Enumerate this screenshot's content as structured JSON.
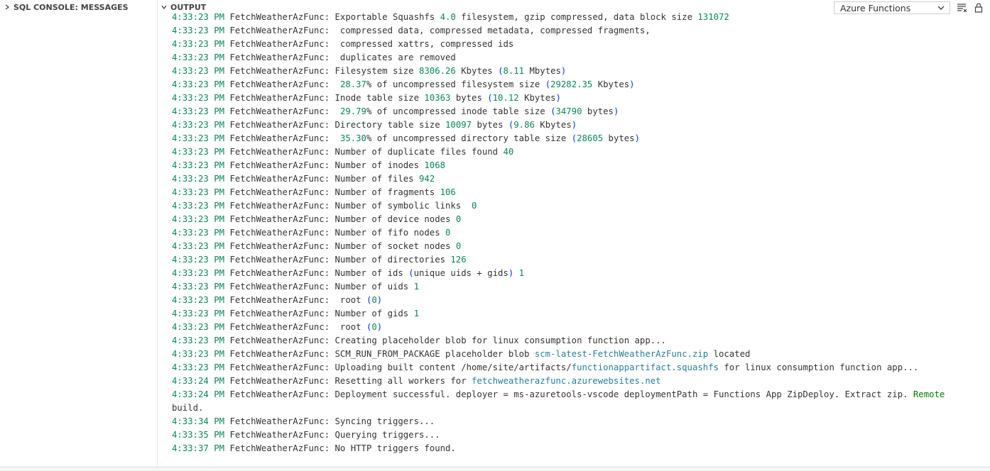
{
  "left_panel": {
    "title": "SQL CONSOLE: MESSAGES"
  },
  "output_panel": {
    "title": "OUTPUT",
    "channel_select": {
      "value": "Azure Functions"
    }
  },
  "log": {
    "prefix": "FetchWeatherAzFunc:",
    "lines": [
      {
        "ts": "4:33:23 PM",
        "parts": [
          {
            "t": "Exportable Squashfs "
          },
          {
            "t": "4.0",
            "c": "num"
          },
          {
            "t": " filesystem, gzip compressed, data block size "
          },
          {
            "t": "131072",
            "c": "num"
          }
        ]
      },
      {
        "ts": "4:33:23 PM",
        "parts": [
          {
            "t": " compressed data, compressed metadata, compressed fragments,"
          }
        ]
      },
      {
        "ts": "4:33:23 PM",
        "parts": [
          {
            "t": " compressed xattrs, compressed ids"
          }
        ]
      },
      {
        "ts": "4:33:23 PM",
        "parts": [
          {
            "t": " duplicates are removed"
          }
        ]
      },
      {
        "ts": "4:33:23 PM",
        "parts": [
          {
            "t": "Filesystem size "
          },
          {
            "t": "8306.26",
            "c": "num"
          },
          {
            "t": " Kbytes "
          },
          {
            "t": "(",
            "c": "paren"
          },
          {
            "t": "8.11",
            "c": "num"
          },
          {
            "t": " Mbytes"
          },
          {
            "t": ")",
            "c": "paren"
          }
        ]
      },
      {
        "ts": "4:33:23 PM",
        "parts": [
          {
            "t": " "
          },
          {
            "t": "28.37",
            "c": "num"
          },
          {
            "t": "% of uncompressed filesystem size "
          },
          {
            "t": "(",
            "c": "paren"
          },
          {
            "t": "29282.35",
            "c": "num"
          },
          {
            "t": " Kbytes"
          },
          {
            "t": ")",
            "c": "paren"
          }
        ]
      },
      {
        "ts": "4:33:23 PM",
        "parts": [
          {
            "t": "Inode table size "
          },
          {
            "t": "10363",
            "c": "num"
          },
          {
            "t": " bytes "
          },
          {
            "t": "(",
            "c": "paren"
          },
          {
            "t": "10.12",
            "c": "num"
          },
          {
            "t": " Kbytes"
          },
          {
            "t": ")",
            "c": "paren"
          }
        ]
      },
      {
        "ts": "4:33:23 PM",
        "parts": [
          {
            "t": " "
          },
          {
            "t": "29.79",
            "c": "num"
          },
          {
            "t": "% of uncompressed inode table size "
          },
          {
            "t": "(",
            "c": "paren"
          },
          {
            "t": "34790",
            "c": "num"
          },
          {
            "t": " bytes"
          },
          {
            "t": ")",
            "c": "paren"
          }
        ]
      },
      {
        "ts": "4:33:23 PM",
        "parts": [
          {
            "t": "Directory table size "
          },
          {
            "t": "10097",
            "c": "num"
          },
          {
            "t": " bytes "
          },
          {
            "t": "(",
            "c": "paren"
          },
          {
            "t": "9.86",
            "c": "num"
          },
          {
            "t": " Kbytes"
          },
          {
            "t": ")",
            "c": "paren"
          }
        ]
      },
      {
        "ts": "4:33:23 PM",
        "parts": [
          {
            "t": " "
          },
          {
            "t": "35.30",
            "c": "num"
          },
          {
            "t": "% of uncompressed directory table size "
          },
          {
            "t": "(",
            "c": "paren"
          },
          {
            "t": "28605",
            "c": "num"
          },
          {
            "t": " bytes"
          },
          {
            "t": ")",
            "c": "paren"
          }
        ]
      },
      {
        "ts": "4:33:23 PM",
        "parts": [
          {
            "t": "Number of duplicate files found "
          },
          {
            "t": "40",
            "c": "num"
          }
        ]
      },
      {
        "ts": "4:33:23 PM",
        "parts": [
          {
            "t": "Number of inodes "
          },
          {
            "t": "1068",
            "c": "num"
          }
        ]
      },
      {
        "ts": "4:33:23 PM",
        "parts": [
          {
            "t": "Number of files "
          },
          {
            "t": "942",
            "c": "num"
          }
        ]
      },
      {
        "ts": "4:33:23 PM",
        "parts": [
          {
            "t": "Number of fragments "
          },
          {
            "t": "106",
            "c": "num"
          }
        ]
      },
      {
        "ts": "4:33:23 PM",
        "parts": [
          {
            "t": "Number of symbolic links  "
          },
          {
            "t": "0",
            "c": "num"
          }
        ]
      },
      {
        "ts": "4:33:23 PM",
        "parts": [
          {
            "t": "Number of device nodes "
          },
          {
            "t": "0",
            "c": "num"
          }
        ]
      },
      {
        "ts": "4:33:23 PM",
        "parts": [
          {
            "t": "Number of fifo nodes "
          },
          {
            "t": "0",
            "c": "num"
          }
        ]
      },
      {
        "ts": "4:33:23 PM",
        "parts": [
          {
            "t": "Number of socket nodes "
          },
          {
            "t": "0",
            "c": "num"
          }
        ]
      },
      {
        "ts": "4:33:23 PM",
        "parts": [
          {
            "t": "Number of directories "
          },
          {
            "t": "126",
            "c": "num"
          }
        ]
      },
      {
        "ts": "4:33:23 PM",
        "parts": [
          {
            "t": "Number of ids "
          },
          {
            "t": "(",
            "c": "paren"
          },
          {
            "t": "unique uids + gids"
          },
          {
            "t": ")",
            "c": "paren"
          },
          {
            "t": " "
          },
          {
            "t": "1",
            "c": "num"
          }
        ]
      },
      {
        "ts": "4:33:23 PM",
        "parts": [
          {
            "t": "Number of uids "
          },
          {
            "t": "1",
            "c": "num"
          }
        ]
      },
      {
        "ts": "4:33:23 PM",
        "parts": [
          {
            "t": " root "
          },
          {
            "t": "(",
            "c": "paren"
          },
          {
            "t": "0",
            "c": "num"
          },
          {
            "t": ")",
            "c": "paren"
          }
        ]
      },
      {
        "ts": "4:33:23 PM",
        "parts": [
          {
            "t": "Number of gids "
          },
          {
            "t": "1",
            "c": "num"
          }
        ]
      },
      {
        "ts": "4:33:23 PM",
        "parts": [
          {
            "t": " root "
          },
          {
            "t": "(",
            "c": "paren"
          },
          {
            "t": "0",
            "c": "num"
          },
          {
            "t": ")",
            "c": "paren"
          }
        ]
      },
      {
        "ts": "4:33:23 PM",
        "parts": [
          {
            "t": "Creating placeholder blob for linux consumption function app..."
          }
        ]
      },
      {
        "ts": "4:33:23 PM",
        "parts": [
          {
            "t": "SCM_RUN_FROM_PACKAGE placeholder blob "
          },
          {
            "t": "scm-latest-FetchWeatherAzFunc.zip",
            "c": "link"
          },
          {
            "t": " located"
          }
        ]
      },
      {
        "ts": "4:33:23 PM",
        "parts": [
          {
            "t": "Uploading built content /home/site/artifacts/"
          },
          {
            "t": "functionappartifact.squashfs",
            "c": "link"
          },
          {
            "t": " for linux consumption function app..."
          }
        ]
      },
      {
        "ts": "4:33:24 PM",
        "parts": [
          {
            "t": "Resetting all workers for "
          },
          {
            "t": "fetchweatherazfunc.azurewebsites.net",
            "c": "link"
          }
        ]
      },
      {
        "ts": "4:33:24 PM",
        "parts": [
          {
            "t": "Deployment successful. deployer = ms-azuretools-vscode deploymentPath = Functions App ZipDeploy. Extract zip. "
          },
          {
            "t": "Remote",
            "c": "hl"
          },
          {
            "t": " build."
          }
        ]
      },
      {
        "ts": "4:33:34 PM",
        "parts": [
          {
            "t": "Syncing triggers..."
          }
        ]
      },
      {
        "ts": "4:33:35 PM",
        "parts": [
          {
            "t": "Querying triggers..."
          }
        ]
      },
      {
        "ts": "4:33:37 PM",
        "parts": [
          {
            "t": "No HTTP triggers found."
          }
        ]
      }
    ]
  },
  "icons": [
    "chevron-right-icon",
    "chevron-down-icon",
    "clear-output-icon",
    "lock-scroll-icon"
  ]
}
